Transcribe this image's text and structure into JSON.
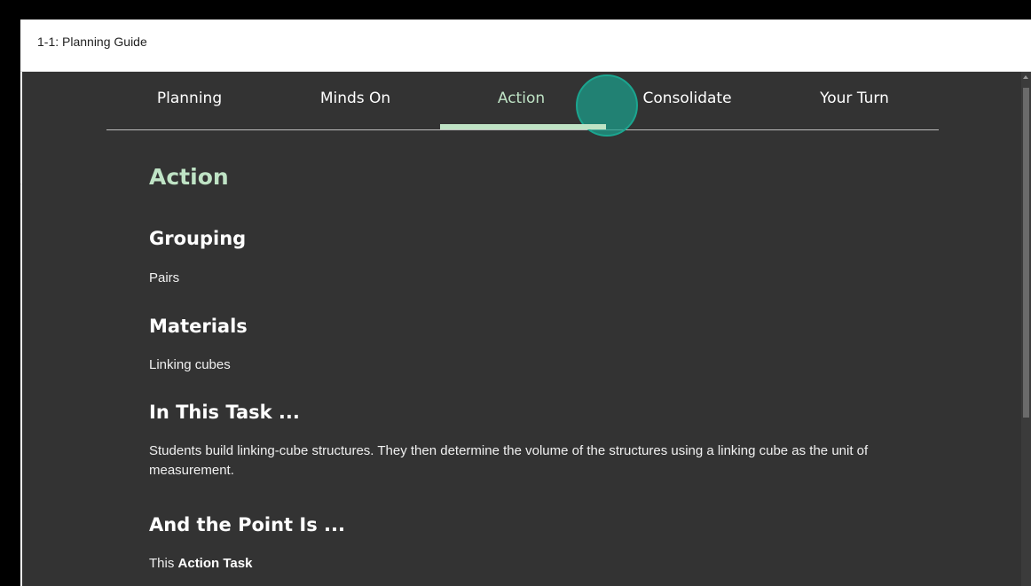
{
  "window": {
    "title": "1-1: Planning Guide"
  },
  "tabs": [
    {
      "label": "Planning"
    },
    {
      "label": "Minds On"
    },
    {
      "label": "Action"
    },
    {
      "label": "Consolidate"
    },
    {
      "label": "Your Turn"
    }
  ],
  "active_tab": "Action",
  "content": {
    "heading": "Action",
    "grouping": {
      "heading": "Grouping",
      "text": "Pairs"
    },
    "materials": {
      "heading": "Materials",
      "text": "Linking cubes"
    },
    "task": {
      "heading": "In This Task ...",
      "text": "Students build linking-cube structures. They then determine the volume of the structures using a linking cube as the unit of measurement."
    },
    "point": {
      "heading": "And the Point Is ...",
      "prefix": "This",
      "bold": "Action Task"
    }
  },
  "colors": {
    "background_dark": "#333333",
    "accent_green": "#bfe3c5",
    "click_indicator": "#1aa08c"
  }
}
